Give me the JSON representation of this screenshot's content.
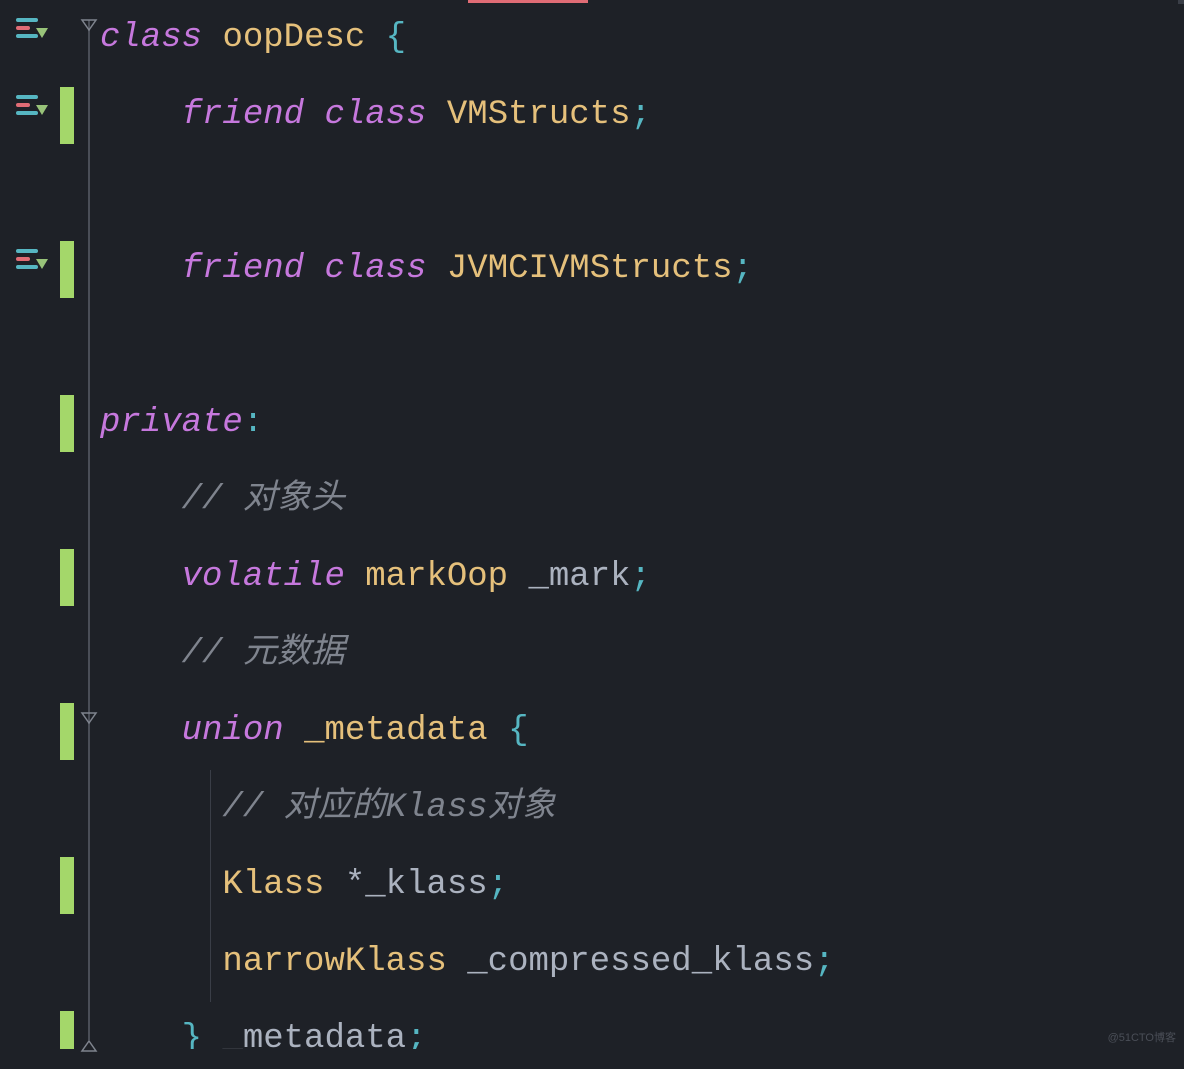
{
  "watermark": "@51CTO博客",
  "code": {
    "lines": [
      {
        "tokens": [
          {
            "text": "class",
            "cls": "keyword"
          },
          {
            "text": " ",
            "cls": "identifier"
          },
          {
            "text": "oopDesc",
            "cls": "type"
          },
          {
            "text": " ",
            "cls": "identifier"
          },
          {
            "text": "{",
            "cls": "brace"
          }
        ],
        "gutter_icon": true,
        "fold_handle": "open",
        "vcs_marker": false,
        "indent": 0
      },
      {
        "tokens": [
          {
            "text": "    ",
            "cls": "identifier"
          },
          {
            "text": "friend",
            "cls": "keyword"
          },
          {
            "text": " ",
            "cls": "identifier"
          },
          {
            "text": "class",
            "cls": "keyword"
          },
          {
            "text": " ",
            "cls": "identifier"
          },
          {
            "text": "VMStructs",
            "cls": "type"
          },
          {
            "text": ";",
            "cls": "brace"
          }
        ],
        "gutter_icon": true,
        "fold_handle": false,
        "vcs_marker": true,
        "indent": 1
      },
      {
        "tokens": [],
        "gutter_icon": false,
        "fold_handle": false,
        "vcs_marker": false,
        "indent": 1
      },
      {
        "tokens": [
          {
            "text": "    ",
            "cls": "identifier"
          },
          {
            "text": "friend",
            "cls": "keyword"
          },
          {
            "text": " ",
            "cls": "identifier"
          },
          {
            "text": "class",
            "cls": "keyword"
          },
          {
            "text": " ",
            "cls": "identifier"
          },
          {
            "text": "JVMCIVMStructs",
            "cls": "type"
          },
          {
            "text": ";",
            "cls": "brace"
          }
        ],
        "gutter_icon": true,
        "fold_handle": false,
        "vcs_marker": true,
        "indent": 1
      },
      {
        "tokens": [],
        "gutter_icon": false,
        "fold_handle": false,
        "vcs_marker": false,
        "indent": 1
      },
      {
        "tokens": [
          {
            "text": "private",
            "cls": "keyword"
          },
          {
            "text": ":",
            "cls": "brace"
          }
        ],
        "gutter_icon": false,
        "fold_handle": false,
        "vcs_marker": true,
        "indent": 0
      },
      {
        "tokens": [
          {
            "text": "    ",
            "cls": "identifier"
          },
          {
            "text": "// 对象头",
            "cls": "comment"
          }
        ],
        "gutter_icon": false,
        "fold_handle": false,
        "vcs_marker": false,
        "indent": 1
      },
      {
        "tokens": [
          {
            "text": "    ",
            "cls": "identifier"
          },
          {
            "text": "volatile",
            "cls": "keyword"
          },
          {
            "text": " ",
            "cls": "identifier"
          },
          {
            "text": "markOop",
            "cls": "type"
          },
          {
            "text": " ",
            "cls": "identifier"
          },
          {
            "text": "_mark",
            "cls": "identifier"
          },
          {
            "text": ";",
            "cls": "brace"
          }
        ],
        "gutter_icon": false,
        "fold_handle": false,
        "vcs_marker": true,
        "indent": 1
      },
      {
        "tokens": [
          {
            "text": "    ",
            "cls": "identifier"
          },
          {
            "text": "// 元数据",
            "cls": "comment"
          }
        ],
        "gutter_icon": false,
        "fold_handle": false,
        "vcs_marker": false,
        "indent": 1
      },
      {
        "tokens": [
          {
            "text": "    ",
            "cls": "identifier"
          },
          {
            "text": "union",
            "cls": "keyword"
          },
          {
            "text": " ",
            "cls": "identifier"
          },
          {
            "text": "_metadata",
            "cls": "type"
          },
          {
            "text": " ",
            "cls": "identifier"
          },
          {
            "text": "{",
            "cls": "brace"
          }
        ],
        "gutter_icon": false,
        "fold_handle": "open",
        "vcs_marker": true,
        "indent": 1
      },
      {
        "tokens": [
          {
            "text": "      ",
            "cls": "identifier"
          },
          {
            "text": "// 对应的",
            "cls": "comment"
          },
          {
            "text": "Klass",
            "cls": "comment"
          },
          {
            "text": "对象",
            "cls": "comment"
          }
        ],
        "gutter_icon": false,
        "fold_handle": false,
        "vcs_marker": false,
        "indent": 2
      },
      {
        "tokens": [
          {
            "text": "      ",
            "cls": "identifier"
          },
          {
            "text": "Klass",
            "cls": "type"
          },
          {
            "text": " ",
            "cls": "identifier"
          },
          {
            "text": "*",
            "cls": "operator"
          },
          {
            "text": "_klass",
            "cls": "identifier"
          },
          {
            "text": ";",
            "cls": "brace"
          }
        ],
        "gutter_icon": false,
        "fold_handle": false,
        "vcs_marker": true,
        "indent": 2
      },
      {
        "tokens": [
          {
            "text": "      ",
            "cls": "identifier"
          },
          {
            "text": "narrowKlass",
            "cls": "type"
          },
          {
            "text": " ",
            "cls": "identifier"
          },
          {
            "text": "_compressed_klass",
            "cls": "identifier"
          },
          {
            "text": ";",
            "cls": "brace"
          }
        ],
        "gutter_icon": false,
        "fold_handle": false,
        "vcs_marker": false,
        "indent": 2
      },
      {
        "tokens": [
          {
            "text": "    ",
            "cls": "identifier"
          },
          {
            "text": "}",
            "cls": "brace"
          },
          {
            "text": " ",
            "cls": "identifier"
          },
          {
            "text": "_metadata",
            "cls": "identifier"
          },
          {
            "text": ";",
            "cls": "brace"
          }
        ],
        "gutter_icon": false,
        "fold_handle": "close",
        "vcs_marker": true,
        "indent": 1,
        "partial": true
      }
    ]
  }
}
